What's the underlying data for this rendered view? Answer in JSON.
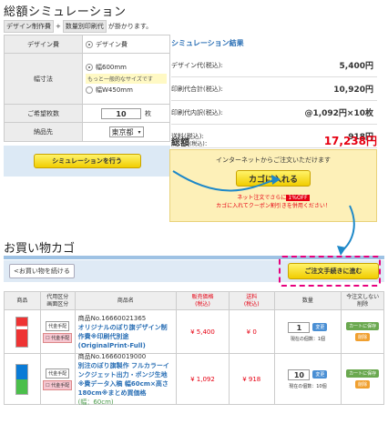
{
  "page": {
    "title": "総額シミュレーション",
    "sub_tag1": "デザイン制作費",
    "sub_plus": "+",
    "sub_tag2": "数量別印刷代",
    "sub_suffix": "が掛かります。"
  },
  "form": {
    "design_label": "デザイン費",
    "design_option": "デザイン費",
    "size_label": "幅寸法",
    "size_opt1": "幅600mm",
    "size_note": "もっと一般的なサイズです",
    "size_opt2": "幅W450mm",
    "qty_label": "ご希望枚数",
    "qty_value": "10",
    "qty_unit": "枚",
    "ship_label": "納品先",
    "ship_value": "東京都"
  },
  "simulate_button": "シミュレーションを行う",
  "results": {
    "heading": "シミュレーション結果",
    "rows": [
      {
        "label": "デザイン代(税込):",
        "value": "5,400円"
      },
      {
        "label": "印刷代合計(税込):",
        "value": "10,920円"
      },
      {
        "label": "印刷代内訳(税込):",
        "value": "@1,092円×10枚"
      },
      {
        "label": "送料(税込):",
        "value": "918円"
      }
    ],
    "total_label": "総額",
    "total_tax": "(税込)：",
    "total_value": "17,238円"
  },
  "cart_promo": {
    "text": "インターネットからご注文いただけます",
    "button": "カゴに入れる",
    "discount_line1_a": "ネット注文でさらに",
    "discount_badge": "1%OFF",
    "discount_line2": "カゴに入れてクーポン割引きを併用ください！"
  },
  "cart": {
    "title": "お買い物カゴ",
    "continue_button": "<お買い物を続ける",
    "checkout_button": "ご注文手続きに進む",
    "headers": [
      "商品",
      "代用区分\n画面区分",
      "商品名",
      "販売価格\n(税込)",
      "送料\n(税込)",
      "数量",
      "今注文しない\n削除"
    ],
    "rows": [
      {
        "code": "商品No.16660021365",
        "name": "オリジナルのぼり旗デザイン制作費※印刷代別途 (OriginalPrint-Full)",
        "price": "¥ 5,400",
        "shipping": "¥ 0",
        "qty": "1",
        "change": "変更",
        "stock": "現在の個数：1個",
        "save": "カートに保存",
        "delete": "削除",
        "badge1": "代金手配",
        "badge2": "☐ 代金手配"
      },
      {
        "code": "商品No.16660019000",
        "name": "別注のぼり旗製作 フルカラーインクジェット出力・ポンジ生地 ※費データ入稿 幅60cm×高さ180cm※まとめ買価格",
        "price": "¥ 1,092",
        "shipping": "¥ 918",
        "qty": "10",
        "change": "変更",
        "stock": "現在の個数：10個",
        "save": "カートに保存",
        "delete": "削除",
        "badge1": "代金手配",
        "badge2": "☐ 代金手配",
        "note": "(幅：60cm)"
      }
    ]
  },
  "colors": {
    "accent_red": "#e60012",
    "accent_blue": "#2a6fb5",
    "highlight_pink": "#e6007e"
  }
}
